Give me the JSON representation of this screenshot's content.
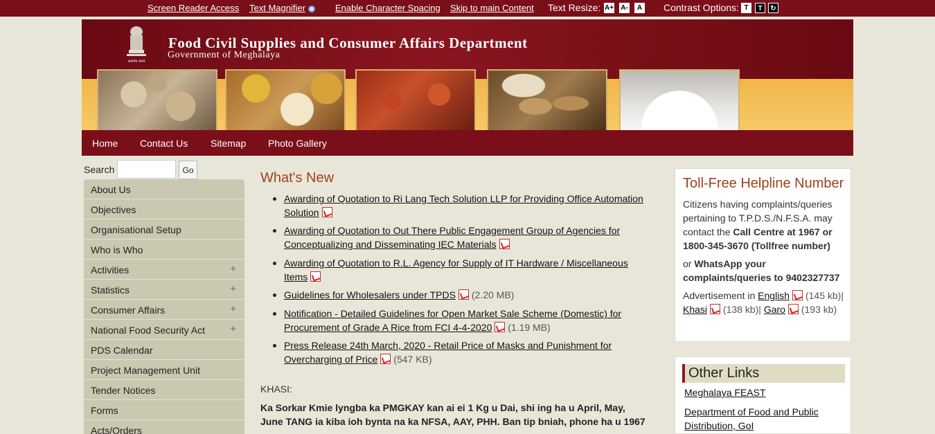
{
  "topbar": {
    "screen_reader": "Screen Reader Access",
    "text_magnifier": "Text Magnifier",
    "char_spacing": "Enable Character Spacing",
    "skip_main": "Skip to main Content",
    "text_resize_label": "Text Resize:",
    "resize_buttons": [
      "A+",
      "A-",
      "A"
    ],
    "contrast_label": "Contrast Options:",
    "contrast_buttons": [
      "T",
      "T"
    ]
  },
  "header": {
    "title": "Food Civil Supplies and Consumer Affairs Department",
    "subtitle": "Government of Meghalaya",
    "emblem_text": "सत्यमेव जयते"
  },
  "nav": {
    "items": [
      "Home",
      "Contact Us",
      "Sitemap",
      "Photo Gallery"
    ]
  },
  "search": {
    "label": "Search",
    "button": "Go",
    "value": ""
  },
  "sidemenu": {
    "items": [
      {
        "label": "About Us",
        "plus": ""
      },
      {
        "label": "Objectives",
        "plus": ""
      },
      {
        "label": "Organisational Setup",
        "plus": ""
      },
      {
        "label": "Who is Who",
        "plus": ""
      },
      {
        "label": "Activities",
        "plus": "+"
      },
      {
        "label": "Statistics",
        "plus": "+"
      },
      {
        "label": "Consumer Affairs",
        "plus": "+"
      },
      {
        "label": "National Food Security Act",
        "plus": "+"
      },
      {
        "label": "PDS Calendar",
        "plus": ""
      },
      {
        "label": "Project Management Unit",
        "plus": ""
      },
      {
        "label": "Tender Notices",
        "plus": ""
      },
      {
        "label": "Forms",
        "plus": ""
      },
      {
        "label": "Acts/Orders",
        "plus": ""
      }
    ]
  },
  "whats_new": {
    "title": "What's New",
    "items": [
      {
        "text": "Awarding of Quotation to Ri Lang Tech Solution LLP for Providing Office Automation Solution",
        "size": ""
      },
      {
        "text": "Awarding of Quotation to Out There Public Engagement Group of Agencies for Conceptualizing and Disseminating IEC Materials",
        "size": ""
      },
      {
        "text": "Awarding of Quotation to R.L. Agency for Supply of IT Hardware / Miscellaneous Items",
        "size": ""
      },
      {
        "text": "Guidelines for Wholesalers under TPDS",
        "size": "(2.20 MB)"
      },
      {
        "text": "Notification - Detailed Guidelines for Open Market Sale Scheme (Domestic) for Procurement of Grade A Rice from FCI 4-4-2020",
        "size": "(1.19 MB)"
      },
      {
        "text": "Press Release 24th March, 2020 - Retail Price of Masks and Punishment for Overcharging of Price",
        "size": "(547 KB)"
      }
    ],
    "khasi_label": "KHASI:",
    "khasi_text": "Ka Sorkar Kmie lyngba ka PMGKAY kan ai ei 1 Kg u Dai, shi ing ha u April, May, June TANG ia kiba ioh bynta na ka NFSA, AAY, PHH. Ban tip bniah, phone ha u 1967"
  },
  "helpline": {
    "title": "Toll-Free Helpline Number",
    "p1_text": "Citizens having complaints/queries pertaining to T.P.D.S./N.F.S.A. may contact the ",
    "p1_bold": "Call Centre at 1967 or 1800-345-3670 (Tollfree number)",
    "p2_text": "or ",
    "p2_bold": "WhatsApp your complaints/queries to 9402327737",
    "adv_label": "Advertisement in ",
    "adv_links": [
      {
        "lang": "English",
        "size": "(145 kb)|"
      },
      {
        "lang": "Khasi",
        "size": "(138 kb)|"
      },
      {
        "lang": "Garo",
        "size": "(193 kb)"
      }
    ]
  },
  "other_links": {
    "title": "Other Links",
    "items": [
      "Meghalaya FEAST",
      "Department of Food and Public Distribution, GoI"
    ]
  }
}
